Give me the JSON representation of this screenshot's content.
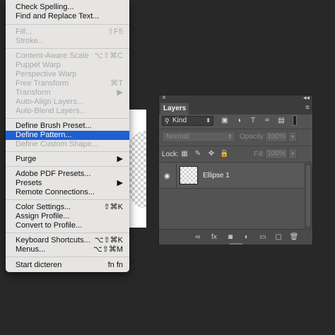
{
  "menu": {
    "items": [
      {
        "label": "Check Spelling...",
        "shortcut": "",
        "disabled": false
      },
      {
        "label": "Find and Replace Text...",
        "shortcut": "",
        "disabled": false
      },
      {
        "label": "Fill...",
        "shortcut": "⇧F5",
        "disabled": true
      },
      {
        "label": "Stroke...",
        "shortcut": "",
        "disabled": true
      },
      {
        "label": "Content-Aware Scale",
        "shortcut": "⌥⇧⌘C",
        "disabled": true
      },
      {
        "label": "Puppet Warp",
        "shortcut": "",
        "disabled": true
      },
      {
        "label": "Perspective Warp",
        "shortcut": "",
        "disabled": true
      },
      {
        "label": "Free Transform",
        "shortcut": "⌘T",
        "disabled": true
      },
      {
        "label": "Transform",
        "shortcut": "▶",
        "disabled": true
      },
      {
        "label": "Auto-Align Layers...",
        "shortcut": "",
        "disabled": true
      },
      {
        "label": "Auto-Blend Layers...",
        "shortcut": "",
        "disabled": true
      },
      {
        "label": "Define Brush Preset...",
        "shortcut": "",
        "disabled": false
      },
      {
        "label": "Define Pattern...",
        "shortcut": "",
        "disabled": false,
        "selected": true
      },
      {
        "label": "Define Custom Shape...",
        "shortcut": "",
        "disabled": true
      },
      {
        "label": "Purge",
        "shortcut": "▶",
        "disabled": false
      },
      {
        "label": "Adobe PDF Presets...",
        "shortcut": "",
        "disabled": false
      },
      {
        "label": "Presets",
        "shortcut": "▶",
        "disabled": false
      },
      {
        "label": "Remote Connections...",
        "shortcut": "",
        "disabled": false
      },
      {
        "label": "Color Settings...",
        "shortcut": "⇧⌘K",
        "disabled": false
      },
      {
        "label": "Assign Profile...",
        "shortcut": "",
        "disabled": false
      },
      {
        "label": "Convert to Profile...",
        "shortcut": "",
        "disabled": false
      },
      {
        "label": "Keyboard Shortcuts...",
        "shortcut": "⌥⇧⌘K",
        "disabled": false
      },
      {
        "label": "Menus...",
        "shortcut": "⌥⇧⌘M",
        "disabled": false
      },
      {
        "label": "Start dicteren",
        "shortcut": "fn fn",
        "disabled": false
      }
    ]
  },
  "layers_panel": {
    "close": "×",
    "collapse": "◂◂",
    "tab_label": "Layers",
    "panel_menu": "≡",
    "filter": {
      "icon": "⚲",
      "kind": "Kind",
      "arrow": "⬍"
    },
    "filter_icons": [
      "▣",
      "◑",
      "T",
      "⌗",
      "▤"
    ],
    "blend_mode": "Normal",
    "blend_arrow": "⬍",
    "opacity_label": "Opacity:",
    "opacity_value": "100%",
    "lock_label": "Lock:",
    "lock_icons": [
      "▦",
      "✎",
      "✥",
      "🔒"
    ],
    "fill_label": "Fill:",
    "fill_value": "100%",
    "dropdown_arrow": "▾",
    "layers": [
      {
        "name": "Ellipse 1",
        "visible": true
      }
    ],
    "visibility_icon": "◉",
    "bottom_icons": [
      "∞",
      "fx",
      "◙",
      "◐",
      "▭",
      "▢",
      "🗑"
    ]
  }
}
